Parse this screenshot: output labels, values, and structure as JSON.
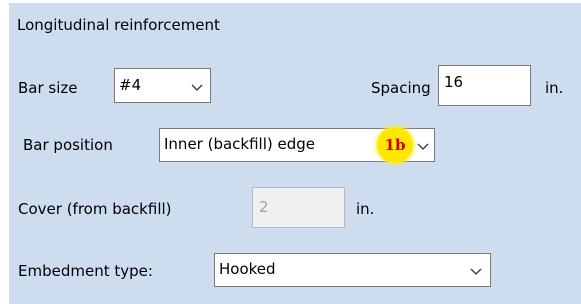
{
  "section_title": "Longitudinal reinforcement",
  "bar_size": {
    "label": "Bar size",
    "selected": "#4"
  },
  "spacing": {
    "label": "Spacing",
    "value": "16",
    "unit": "in."
  },
  "bar_position": {
    "label": "Bar position",
    "selected": "Inner (backfill) edge"
  },
  "annotation_badge": {
    "text": "1b",
    "color": "#ffe700",
    "text_color": "#cc0000"
  },
  "cover": {
    "label": "Cover (from backfill)",
    "value": "2",
    "unit": "in."
  },
  "embedment_type": {
    "label": "Embedment type:",
    "selected": "Hooked"
  },
  "colors": {
    "panel_background": "#cdddef",
    "field_border": "#7a7a7a"
  },
  "icons": {
    "dropdown": "chevron-down-icon"
  }
}
